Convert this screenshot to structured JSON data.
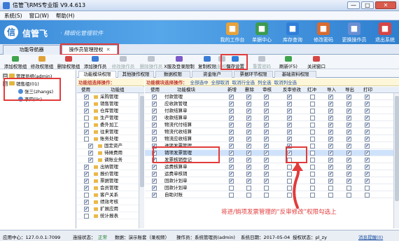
{
  "app": {
    "title": "信管飞RMS专业版 V9.4.613"
  },
  "window_buttons": {
    "minimize": "—",
    "maximize": "□",
    "close": "✕"
  },
  "menu": [
    "系统(S)",
    "窗口(W)",
    "帮助(H)"
  ],
  "banner": {
    "logo_text": "信",
    "brand": "信管飞",
    "slogan": "· 精细化管理软件",
    "buttons": [
      {
        "label": "我的工作台",
        "icon": "desk-icon",
        "color": "#e6a23c"
      },
      {
        "label": "单据中心",
        "icon": "documents-icon",
        "color": "#3b9b4f"
      },
      {
        "label": "库存查询",
        "icon": "warehouse-icon",
        "color": "#2f7ed8"
      },
      {
        "label": "修改密码",
        "icon": "key-icon",
        "color": "#d86b2f"
      },
      {
        "label": "更换操作员",
        "icon": "user-switch-icon",
        "color": "#6a8fd3"
      },
      {
        "label": "退出系统",
        "icon": "exit-icon",
        "color": "#d64545"
      }
    ]
  },
  "tabs": [
    {
      "label": "功能导航器",
      "close": ""
    },
    {
      "label": "操作员管理授权",
      "close": "✕"
    }
  ],
  "toolbar": [
    {
      "label": "添加权限组",
      "color": "#3fa34d",
      "disabled": false
    },
    {
      "label": "修改权限组",
      "color": "#e0a33a",
      "disabled": false
    },
    {
      "label": "删除权限组",
      "color": "#d64545",
      "disabled": false
    },
    {
      "label": "添加操作员",
      "color": "#3b7bd6",
      "disabled": false
    },
    {
      "label": "修改操作员",
      "color": "#c58a2a",
      "disabled": true
    },
    {
      "label": "删除操作员",
      "color": "#d64545",
      "disabled": true
    },
    {
      "label": "X服及登录限制",
      "color": "#7b5ac8",
      "disabled": false
    },
    {
      "label": "复制权限",
      "color": "#3b7bd6",
      "disabled": false
    },
    {
      "label": "粘贴权限",
      "color": "#3b7bd6",
      "disabled": true
    },
    {
      "label": "保存设置",
      "color": "#2f7ed8",
      "disabled": false
    },
    {
      "label": "重置密码",
      "color": "#c58a2a",
      "disabled": true
    },
    {
      "label": "刷新(F5)",
      "color": "#3fa34d",
      "disabled": false
    },
    {
      "label": "关闭窗口",
      "color": "#d64545",
      "disabled": false
    }
  ],
  "tree": [
    {
      "label": "管理员组(admin)",
      "level": 0,
      "expander": "⊟",
      "kind": "folder"
    },
    {
      "label": "销售组(01)",
      "level": 0,
      "expander": "⊟",
      "kind": "folder"
    },
    {
      "label": "张三(zhangs)",
      "level": 1,
      "expander": "",
      "kind": "user"
    },
    {
      "label": "李四(lis)",
      "level": 1,
      "expander": "",
      "kind": "user"
    }
  ],
  "perm_tabs": [
    "功能模块权限",
    "其他操作权限",
    "数据权限",
    "资金账户",
    "票据环节权限",
    "基础资料权限"
  ],
  "left_op": {
    "prefix": "功能组选择操作：",
    "select_all": "全部选中",
    "cancel_all": "全部取消"
  },
  "right_op": {
    "prefix": "功能模块选择操作：",
    "select_all": "全部选中",
    "cancel_all": "全部取消",
    "cancel_row": "取消行全选",
    "select_col": "列全选",
    "cancel_col": "取消列全选"
  },
  "left_headers": {
    "use": "使用",
    "group": "功能组"
  },
  "left_rows": [
    {
      "label": "采购管理",
      "checked": true,
      "indent": 1
    },
    {
      "label": "销售管理",
      "checked": true,
      "indent": 1
    },
    {
      "label": "仓库管理",
      "checked": true,
      "indent": 1
    },
    {
      "label": "生产管理",
      "checked": false,
      "indent": 1
    },
    {
      "label": "委外加工",
      "checked": false,
      "indent": 1
    },
    {
      "label": "往来管理",
      "checked": true,
      "indent": 1
    },
    {
      "label": "账务处理",
      "checked": false,
      "indent": 1
    },
    {
      "label": "固定资产",
      "checked": true,
      "indent": 2
    },
    {
      "label": "待摊费用",
      "checked": true,
      "indent": 2
    },
    {
      "label": "调账业务",
      "checked": true,
      "indent": 2
    },
    {
      "label": "出纳管理",
      "checked": true,
      "indent": 1
    },
    {
      "label": "报价管理",
      "checked": true,
      "indent": 1
    },
    {
      "label": "票据管理",
      "checked": true,
      "indent": 1
    },
    {
      "label": "会员管理",
      "checked": true,
      "indent": 1
    },
    {
      "label": "客户关系",
      "checked": false,
      "indent": 1
    },
    {
      "label": "绩效考核",
      "checked": true,
      "indent": 1
    },
    {
      "label": "扩展应用",
      "checked": true,
      "indent": 1
    },
    {
      "label": "统计报表",
      "checked": false,
      "indent": 1
    }
  ],
  "right_headers": [
    "使用",
    "功能模块",
    "新增",
    "删除",
    "审核",
    "反审修改",
    "红冲",
    "导入",
    "导出",
    "打印"
  ],
  "right_rows": [
    {
      "label": "付款管理",
      "use": true,
      "perms": [
        true,
        true,
        true,
        true,
        false,
        true,
        true,
        true
      ]
    },
    {
      "label": "应收款管理",
      "use": true,
      "perms": [
        true,
        true,
        true,
        true,
        false,
        true,
        true,
        true
      ]
    },
    {
      "label": "付款结算单",
      "use": true,
      "perms": [
        true,
        true,
        true,
        true,
        false,
        true,
        true,
        true
      ]
    },
    {
      "label": "收款结算单",
      "use": true,
      "perms": [
        true,
        true,
        true,
        true,
        false,
        true,
        true,
        true
      ]
    },
    {
      "label": "物流代付结算",
      "use": true,
      "perms": [
        true,
        true,
        true,
        true,
        false,
        true,
        true,
        true
      ]
    },
    {
      "label": "物流代收结算",
      "use": true,
      "perms": [
        true,
        true,
        true,
        true,
        false,
        true,
        true,
        true
      ]
    },
    {
      "label": "物流应收结算",
      "use": true,
      "perms": [
        true,
        true,
        true,
        true,
        false,
        true,
        true,
        true
      ]
    },
    {
      "label": "进项发票管理",
      "use": true,
      "perms": [
        true,
        true,
        true,
        true,
        false,
        true,
        true,
        true
      ]
    },
    {
      "label": "销项发票管理",
      "use": true,
      "perms": [
        true,
        true,
        true,
        true,
        false,
        true,
        true,
        true
      ]
    },
    {
      "label": "发票核销登记",
      "use": true,
      "perms": [
        true,
        true,
        true,
        false,
        false,
        true,
        true,
        true
      ]
    },
    {
      "label": "运费核算单",
      "use": true,
      "perms": [
        true,
        true,
        true,
        false,
        false,
        true,
        true,
        true
      ]
    },
    {
      "label": "运费单核销",
      "use": true,
      "perms": [
        true,
        true,
        true,
        false,
        false,
        true,
        true,
        true
      ]
    },
    {
      "label": "回款计划单",
      "use": true,
      "perms": [
        true,
        true,
        true,
        false,
        false,
        true,
        true,
        true
      ]
    },
    {
      "label": "回款计划单",
      "use": true,
      "perms": [
        false,
        false,
        false,
        false,
        false,
        false,
        false,
        false
      ]
    },
    {
      "label": "自助对账",
      "use": true,
      "perms": [
        false,
        false,
        false,
        false,
        false,
        false,
        false,
        false
      ]
    }
  ],
  "annotation": "将进/销项发票管理的“反审修改”权限勾选上",
  "status": {
    "server": "应用中心：127.0.0.1:7099",
    "conn_label": "连接状态：",
    "conn_value": "正常",
    "account": "数据：演示账套（录视频）",
    "operator": "操作员：系统管理员(admin)",
    "date": "系统日期：2017-05-04",
    "auth": "授权状态：pl_zy",
    "msg": "消息提醒(0)"
  },
  "colors": {
    "accent": "#2f7ed8",
    "highlight": "#e23b3b",
    "banner": "#3a8ad8"
  }
}
